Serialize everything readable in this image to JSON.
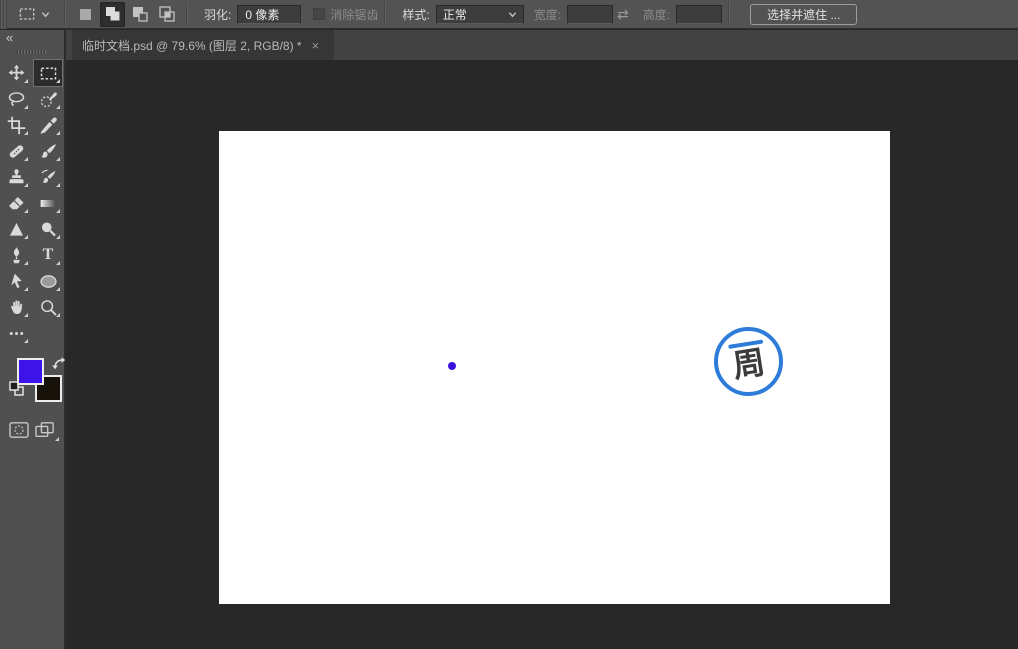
{
  "options_bar": {
    "feather_label": "羽化:",
    "feather_value": "0 像素",
    "antialias_label": "消除锯齿",
    "style_label": "样式:",
    "style_value": "正常",
    "width_label": "宽度:",
    "width_value": "",
    "swap_dims_glyph": "⇄",
    "height_label": "高度:",
    "height_value": "",
    "select_and_mask_label": "选择并遮住 ...",
    "selection_modes": [
      "new-selection",
      "add-to-selection",
      "subtract-from-selection",
      "intersect-selection"
    ],
    "active_selection_mode": "add-to-selection",
    "active_tool_preset": "rectangular-marquee"
  },
  "tab_bar": {
    "collapse_glyph": "«",
    "tab_title": "临时文档.psd @ 79.6% (图层 2, RGB/8) *",
    "tab_close_glyph": "×"
  },
  "toolbar": {
    "tools": [
      "move",
      "rectangular-marquee",
      "lasso",
      "quick-selection",
      "crop",
      "eyedropper",
      "spot-healing-brush",
      "brush",
      "clone-stamp",
      "history-brush",
      "eraser",
      "gradient",
      "blur",
      "dodge",
      "pen",
      "type",
      "path-selection",
      "ellipse-shape",
      "hand",
      "zoom",
      "edit-toolbar"
    ],
    "selected_tool": "rectangular-marquee",
    "type_tool_glyph": "T",
    "foreground_color": "#3c14ea",
    "background_color": "#17130b"
  },
  "canvas": {
    "dot_color": "#3a10e0",
    "logo_ring_color": "#2e7cd9",
    "logo_char": "周"
  }
}
